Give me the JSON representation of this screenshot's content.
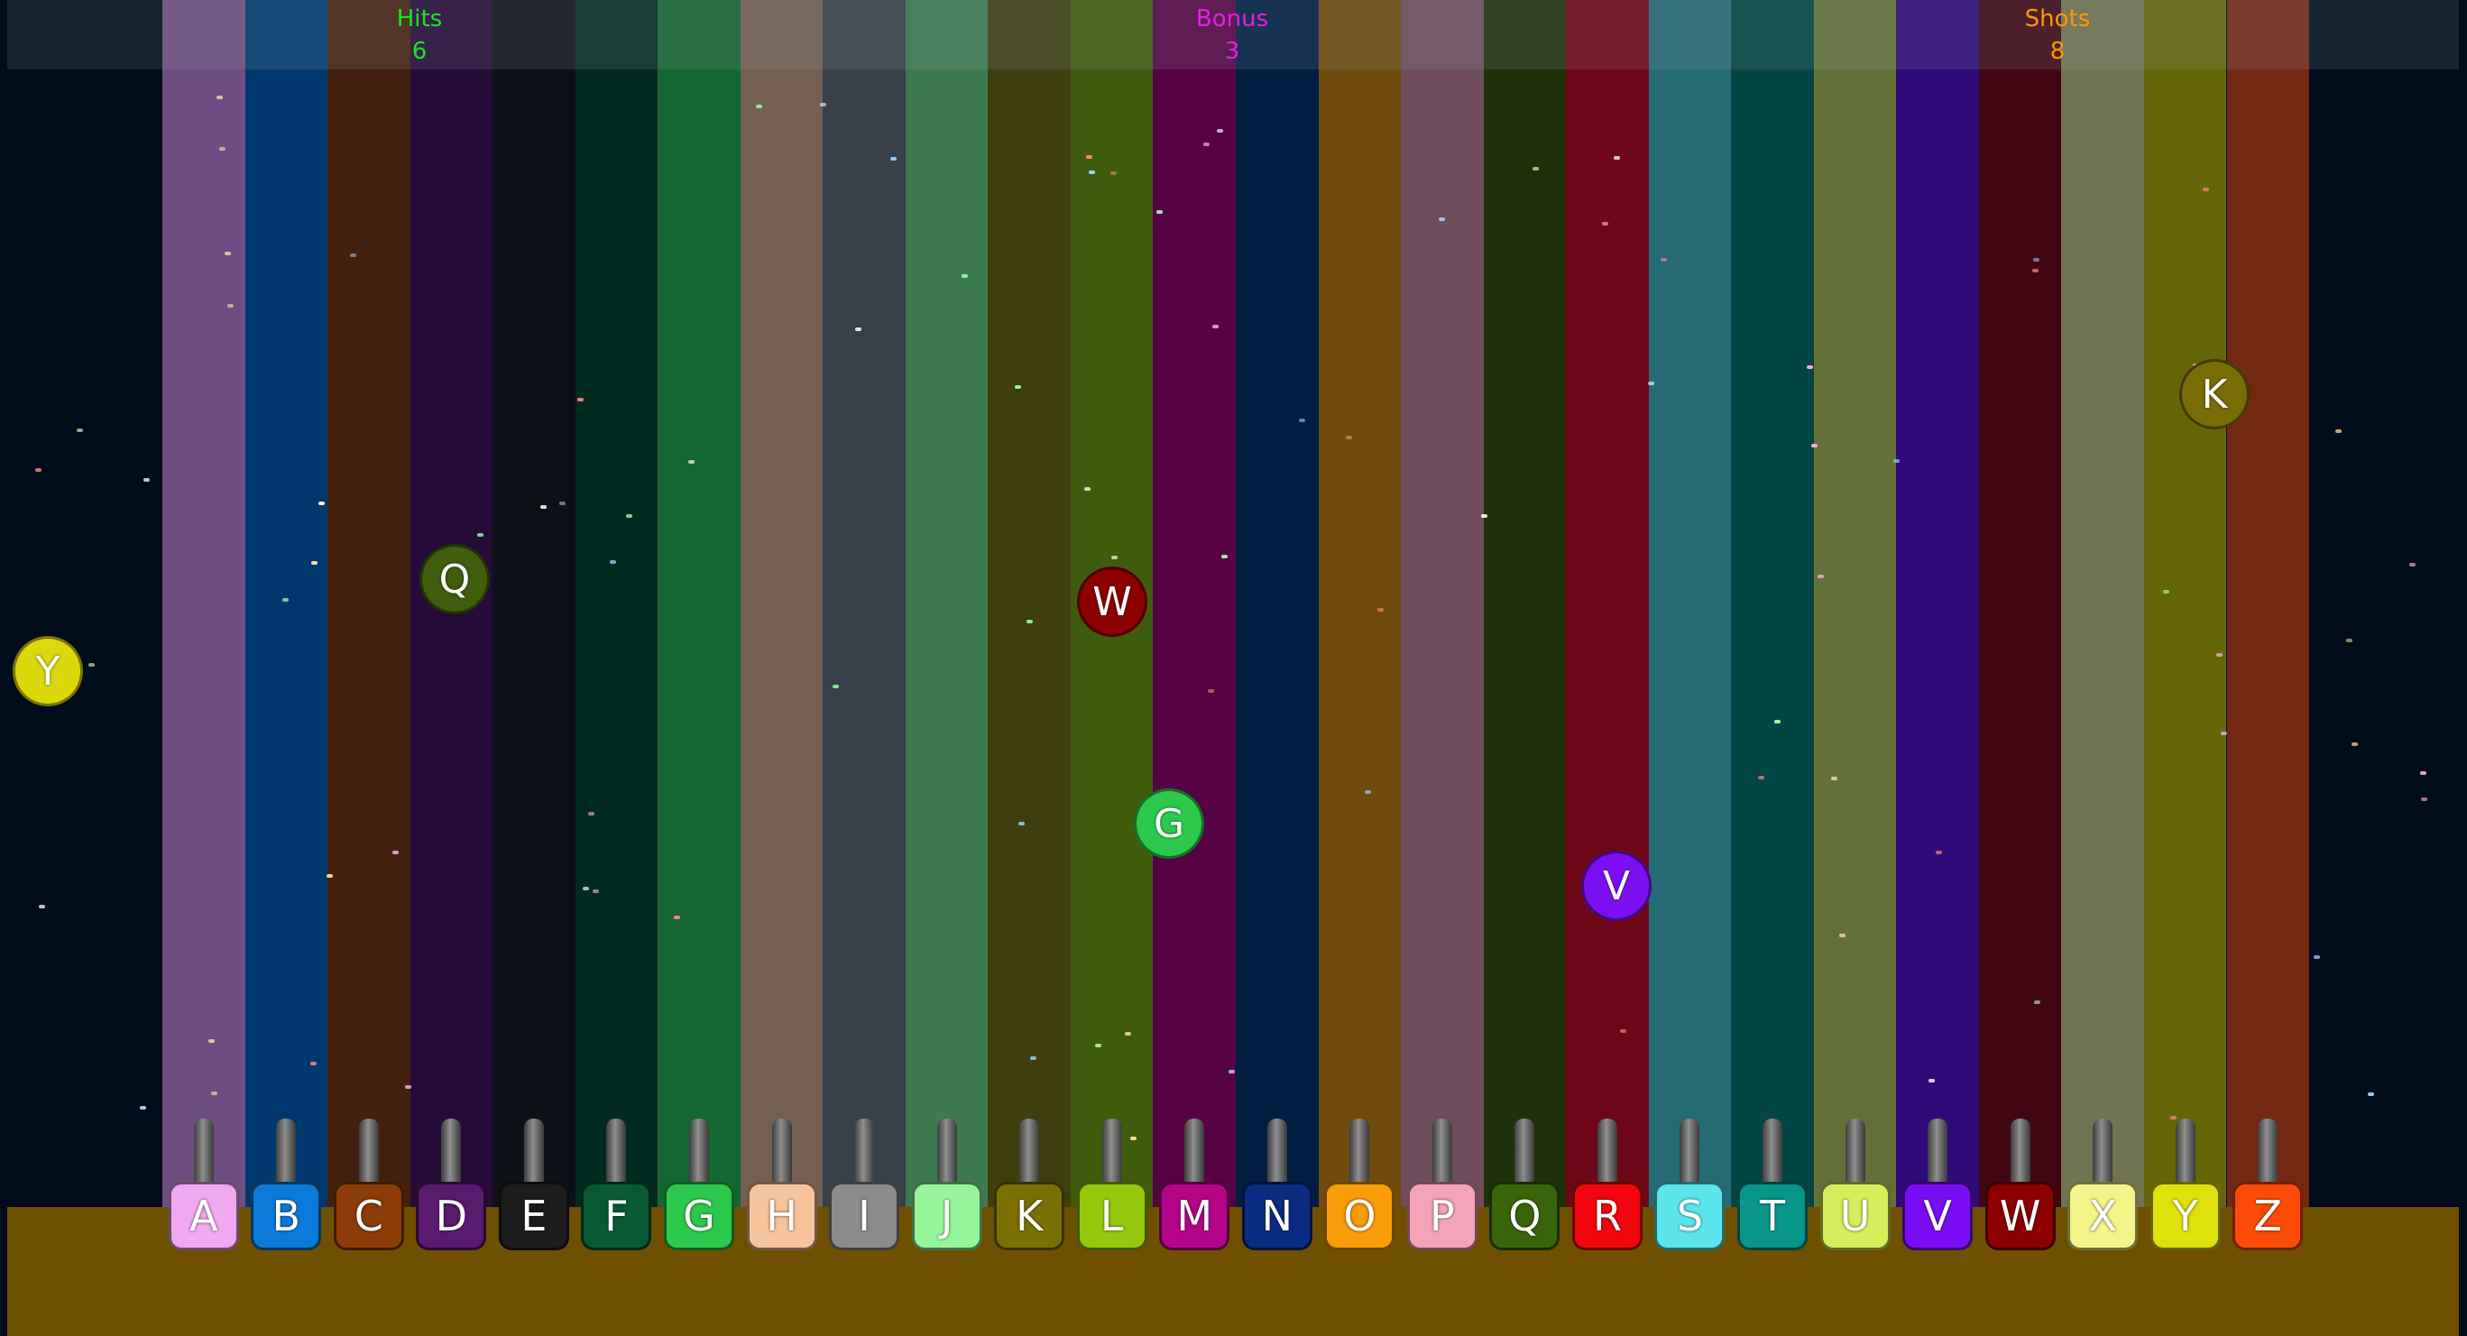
{
  "hud": {
    "hits": {
      "label": "Hits",
      "value": "6",
      "color": "#22e022"
    },
    "bonus": {
      "label": "Bonus",
      "value": "3",
      "color": "#e020e0"
    },
    "shots": {
      "label": "Shots",
      "value": "8",
      "color": "#ff9900"
    }
  },
  "lanes": [
    {
      "letter": "A",
      "color": "#6e4e82",
      "key_color": "#f0a8f0"
    },
    {
      "letter": "B",
      "color": "#00386e",
      "key_color": "#0c7ad8"
    },
    {
      "letter": "C",
      "color": "#44210e",
      "key_color": "#8c3c06"
    },
    {
      "letter": "D",
      "color": "#260a38",
      "key_color": "#5a1a6e"
    },
    {
      "letter": "E",
      "color": "#0d1117",
      "key_color": "#1c1c1c"
    },
    {
      "letter": "F",
      "color": "#012b20",
      "key_color": "#075a33"
    },
    {
      "letter": "G",
      "color": "#156731",
      "key_color": "#2dc94d"
    },
    {
      "letter": "H",
      "color": "#745f51",
      "key_color": "#f6c49c"
    },
    {
      "letter": "I",
      "color": "#373f48",
      "key_color": "#8c8c8c"
    },
    {
      "letter": "J",
      "color": "#3e7a4f",
      "key_color": "#96f59a"
    },
    {
      "letter": "K",
      "color": "#3e3e0f",
      "key_color": "#7a7004"
    },
    {
      "letter": "L",
      "color": "#3f5c0c",
      "key_color": "#94c80c"
    },
    {
      "letter": "M",
      "color": "#560345",
      "key_color": "#b40488"
    },
    {
      "letter": "N",
      "color": "#001d42",
      "key_color": "#0c2c82"
    },
    {
      "letter": "O",
      "color": "#6f4b0e",
      "key_color": "#f89c08"
    },
    {
      "letter": "P",
      "color": "#6f4d5d",
      "key_color": "#f4a4b8"
    },
    {
      "letter": "Q",
      "color": "#1e3109",
      "key_color": "#39650a"
    },
    {
      "letter": "R",
      "color": "#6e0818",
      "key_color": "#f2050c"
    },
    {
      "letter": "S",
      "color": "#266a76",
      "key_color": "#5ae6ec"
    },
    {
      "letter": "T",
      "color": "#014544",
      "key_color": "#079689"
    },
    {
      "letter": "U",
      "color": "#637138",
      "key_color": "#d6ee5c"
    },
    {
      "letter": "V",
      "color": "#300a78",
      "key_color": "#7a0cf4"
    },
    {
      "letter": "W",
      "color": "#400612",
      "key_color": "#8c0000"
    },
    {
      "letter": "X",
      "color": "#707450",
      "key_color": "#f4f48a"
    },
    {
      "letter": "Y",
      "color": "#646608",
      "key_color": "#e0e00a"
    },
    {
      "letter": "Z",
      "color": "#722812",
      "key_color": "#fc4b08"
    }
  ],
  "balls": [
    {
      "letter": "Y",
      "color": "#dcd80c"
    },
    {
      "letter": "Q",
      "color": "#3f5d0c"
    },
    {
      "letter": "W",
      "color": "#8c0000"
    },
    {
      "letter": "G",
      "color": "#2dc94d"
    },
    {
      "letter": "V",
      "color": "#7a10f2"
    },
    {
      "letter": "K",
      "color": "#7a6c06"
    }
  ]
}
